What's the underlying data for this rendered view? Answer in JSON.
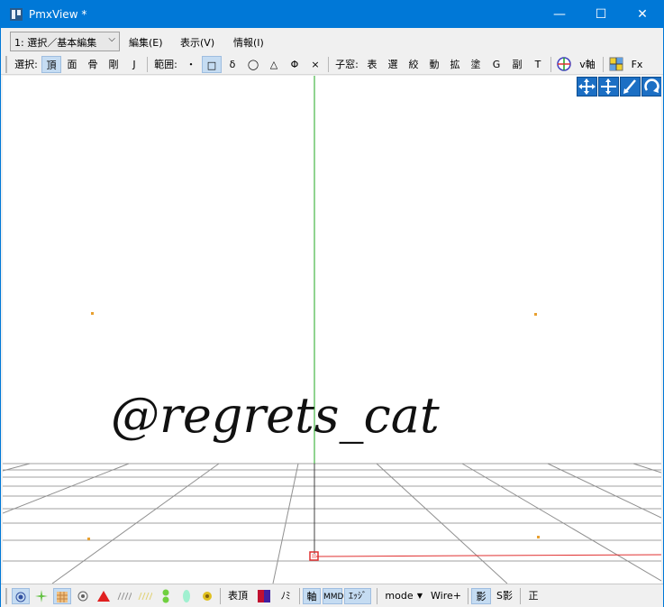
{
  "window": {
    "title": "PmxView *",
    "minimize_glyph": "—",
    "maximize_glyph": "☐",
    "close_glyph": "✕"
  },
  "menubar": {
    "mode_select": "1: 選択／基本編集",
    "items": [
      "編集(E)",
      "表示(V)",
      "情報(I)"
    ]
  },
  "toolbar": {
    "select_label": "選択:",
    "select_items": [
      "頂",
      "面",
      "骨",
      "剛",
      "J"
    ],
    "range_label": "範囲:",
    "range_items": [
      "・",
      "□",
      "δ",
      "◯",
      "△",
      "Φ",
      "×"
    ],
    "sub_label": "子窓:",
    "sub_items": [
      "表",
      "選",
      "絞",
      "動",
      "拡",
      "塗",
      "G",
      "副",
      "T"
    ],
    "axis_label": "v軸",
    "fx_label": "Fx"
  },
  "viewport": {
    "watermark": "@regrets_cat",
    "axis_colors": {
      "y": "#22a822",
      "x": "#e03030",
      "grid": "#9a9a9a",
      "point": "#e8a030"
    }
  },
  "statusbar": {
    "vertex_label": "表頂",
    "mini_label": "ﾉﾐ",
    "axis_label": "軸",
    "mmd_label": "MMD",
    "edge_label": "ｴｯｼﾞ",
    "mode_label": "mode",
    "wire_label": "Wire+",
    "shadow_label": "影",
    "sshadow_label": "S影",
    "front_label": "正"
  }
}
